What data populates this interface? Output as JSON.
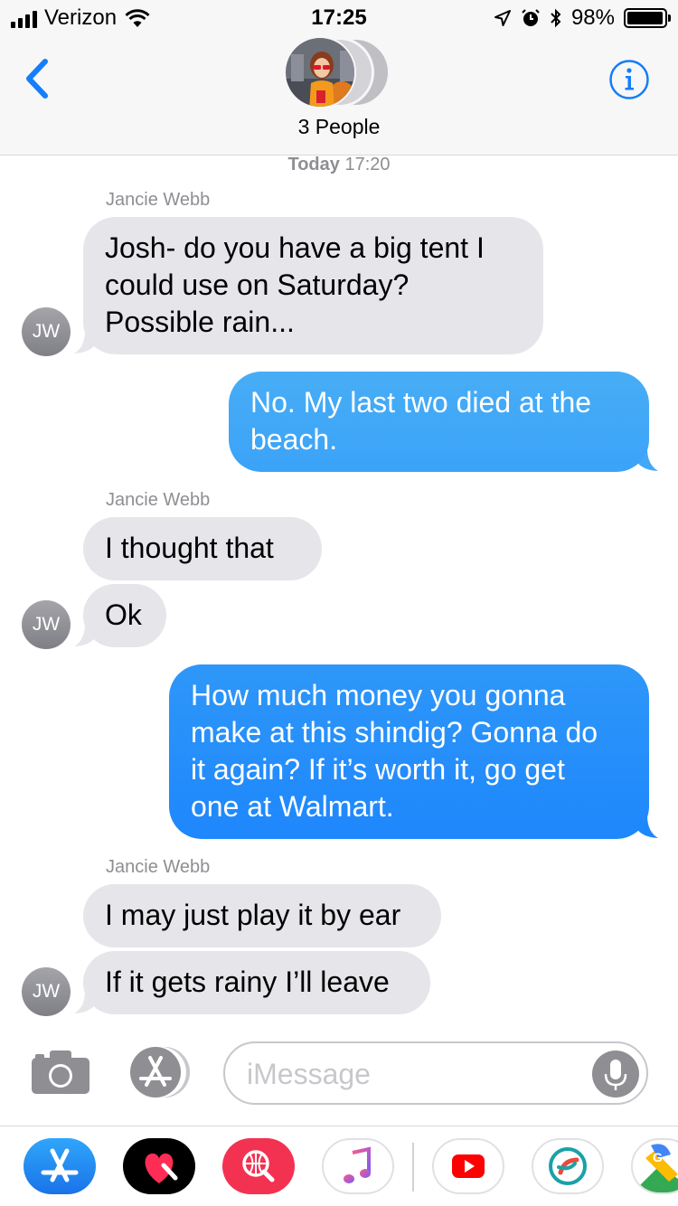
{
  "status_bar": {
    "carrier": "Verizon",
    "time": "17:25",
    "battery_percent": "98%",
    "battery_level": 0.98
  },
  "header": {
    "title": "3 People",
    "back_icon": "chevron-left-icon",
    "info_icon": "info-icon"
  },
  "conversation": {
    "timestamp_day": "Today",
    "timestamp_time": "17:20",
    "messages": [
      {
        "id": "m1",
        "direction": "incoming",
        "sender": "Jancie Webb",
        "text": "Josh- do you have a big tent I could use on Saturday? Possible rain...",
        "lines": [
          "Josh- do you have a big tent I",
          "could use on Saturday?",
          "Possible rain..."
        ],
        "avatar_initials": "JW"
      },
      {
        "id": "m2",
        "direction": "outgoing",
        "text": "No. My last two died at the beach.",
        "lines": [
          "No. My last two died at the",
          "beach."
        ]
      },
      {
        "id": "m3",
        "direction": "incoming",
        "sender": "Jancie Webb",
        "text": "I thought that",
        "lines": [
          "I thought that"
        ]
      },
      {
        "id": "m4",
        "direction": "incoming",
        "text": "Ok",
        "lines": [
          "Ok"
        ],
        "avatar_initials": "JW"
      },
      {
        "id": "m5",
        "direction": "outgoing",
        "text": "How much money you gonna make at this shindig? Gonna do it again? If it’s worth it, go get one at Walmart.",
        "lines": [
          "How much money you gonna",
          "make at this shindig? Gonna do",
          "it again? If it’s worth it, go get",
          "one at Walmart."
        ]
      },
      {
        "id": "m6",
        "direction": "incoming",
        "sender": "Jancie Webb",
        "text": "I may just play it by ear",
        "lines": [
          "I may just play it by ear"
        ]
      },
      {
        "id": "m7",
        "direction": "incoming",
        "text": "If it gets rainy I’ll leave",
        "lines": [
          "If it gets rainy I’ll leave"
        ],
        "avatar_initials": "JW"
      }
    ]
  },
  "input_bar": {
    "placeholder": "iMessage",
    "camera_icon": "camera-icon",
    "appstore_icon": "app-store-icon",
    "mic_icon": "microphone-icon"
  },
  "app_drawer": {
    "apps": [
      "App Store",
      "Digital Touch",
      "Web Images",
      "Music",
      "YouTube",
      "Sygic",
      "Google Maps"
    ]
  },
  "colors": {
    "incoming_bubble": "#e5e5ea",
    "outgoing_bubble_top": "#46abf6",
    "outgoing_bubble_bottom": "#1e87fc",
    "accent": "#147efb",
    "meta_gray": "#8e8e93"
  }
}
